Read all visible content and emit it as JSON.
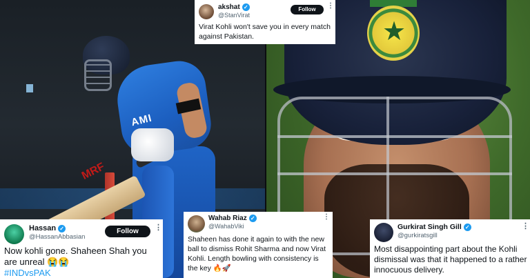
{
  "photos": {
    "left": {
      "bat_brand": "MRF",
      "jersey_text": "AMI"
    },
    "right": {
      "badge": "star-badge-icon"
    }
  },
  "tweets": [
    {
      "id": "akshat",
      "name": "akshat",
      "verified": true,
      "handle": "@StanVirat",
      "follow_label": "Follow",
      "more": "⋮",
      "text": "Virat Kohli won't save you in every match against Pakistan.",
      "hashtag": ""
    },
    {
      "id": "hassan",
      "name": "Hassan",
      "verified": true,
      "handle": "@HassanAbbasian",
      "follow_label": "Follow",
      "more": "⋮",
      "text": "Now kohli gone. Shaheen Shah you are unreal 😭😭",
      "hashtag": "#INDvsPAK"
    },
    {
      "id": "wahab",
      "name": "Wahab Riaz",
      "verified": true,
      "handle": "@WahabViki",
      "more": "⋮",
      "text": "Shaheen has done it again to with the new ball to dismiss Rohit Sharma and now Virat Kohli. Length bowling with consistency is the key 🔥🚀",
      "hashtag": ""
    },
    {
      "id": "gurkirat",
      "name": "Gurkirat Singh Gill",
      "verified": true,
      "handle": "@gurkiratsgill",
      "more": "⋮",
      "text": "Most disappointing part about the Kohli dismissal was that it happened to a rather innocuous delivery.",
      "hashtag": ""
    }
  ],
  "colors": {
    "verified_blue": "#1d9bf0",
    "follow_button_bg": "#0f1419",
    "hashtag": "#1d9bf0",
    "jersey_blue": "#1c5fc0"
  }
}
